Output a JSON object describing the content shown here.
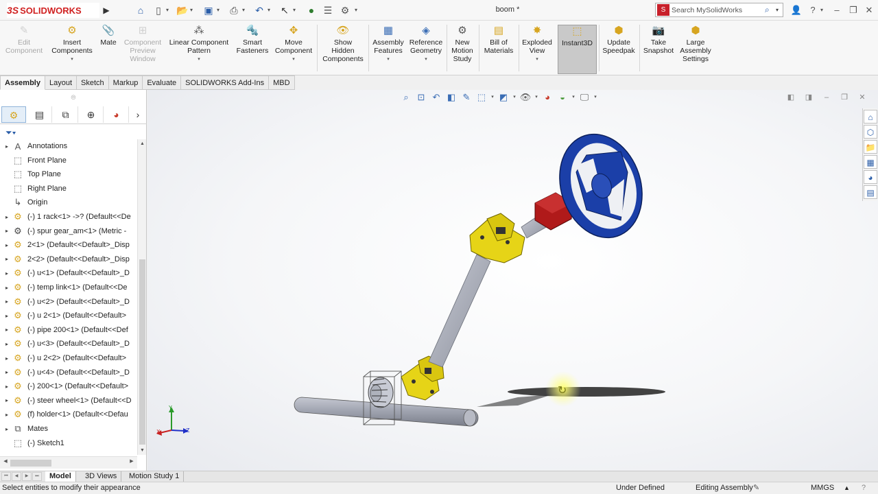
{
  "app": {
    "logo_ds": "3S",
    "logo_text": "SOLIDWORKS",
    "doc_title": "boom *"
  },
  "search": {
    "placeholder": "Search MySolidWorks"
  },
  "quick_access": [
    "home-icon",
    "new-icon",
    "open-icon",
    "save-icon",
    "print-icon",
    "undo-icon",
    "select-icon",
    "rebuild-icon",
    "file-properties-icon",
    "options-icon"
  ],
  "commands": [
    {
      "label": "Edit\nComponent",
      "icon": "edit-component-icon",
      "disabled": true
    },
    {
      "label": "Insert\nComponents",
      "icon": "insert-components-icon",
      "dropdown": true
    },
    {
      "label": "Mate",
      "icon": "mate-icon"
    },
    {
      "label": "Component\nPreview\nWindow",
      "icon": "component-preview-icon",
      "disabled": true
    },
    {
      "label": "Linear Component\nPattern",
      "icon": "linear-pattern-icon",
      "dropdown": true
    },
    {
      "label": "Smart\nFasteners",
      "icon": "smart-fasteners-icon"
    },
    {
      "label": "Move\nComponent",
      "icon": "move-component-icon",
      "dropdown": true
    },
    {
      "label": "Show\nHidden\nComponents",
      "icon": "show-hidden-icon"
    },
    {
      "label": "Assembly\nFeatures",
      "icon": "assembly-features-icon",
      "dropdown": true
    },
    {
      "label": "Reference\nGeometry",
      "icon": "reference-geometry-icon",
      "dropdown": true
    },
    {
      "label": "New\nMotion\nStudy",
      "icon": "motion-study-icon"
    },
    {
      "label": "Bill of\nMaterials",
      "icon": "bom-icon"
    },
    {
      "label": "Exploded\nView",
      "icon": "exploded-view-icon",
      "dropdown": true
    },
    {
      "label": "Instant3D",
      "icon": "instant3d-icon",
      "active": true
    },
    {
      "label": "Update\nSpeedpak",
      "icon": "speedpak-icon"
    },
    {
      "label": "Take\nSnapshot",
      "icon": "snapshot-icon"
    },
    {
      "label": "Large\nAssembly\nSettings",
      "icon": "large-assembly-icon"
    }
  ],
  "tabs": [
    "Assembly",
    "Layout",
    "Sketch",
    "Markup",
    "Evaluate",
    "SOLIDWORKS Add-Ins",
    "MBD"
  ],
  "active_tab": "Assembly",
  "tree": [
    {
      "label": "Annotations",
      "icon": "annotations-icon",
      "expand": true
    },
    {
      "label": "Front Plane",
      "icon": "plane-icon",
      "expand": false
    },
    {
      "label": "Top Plane",
      "icon": "plane-icon",
      "expand": false
    },
    {
      "label": "Right Plane",
      "icon": "plane-icon",
      "expand": false
    },
    {
      "label": "Origin",
      "icon": "origin-icon",
      "expand": false
    },
    {
      "label": "(-) 1 rack<1> ->? (Default<<De",
      "icon": "part-icon",
      "expand": true
    },
    {
      "label": "(-) spur gear_am<1> (Metric -",
      "icon": "toolbox-part-icon",
      "expand": true
    },
    {
      "label": "2<1> (Default<<Default>_Disp",
      "icon": "part-icon",
      "expand": true
    },
    {
      "label": "2<2> (Default<<Default>_Disp",
      "icon": "part-icon",
      "expand": true
    },
    {
      "label": "(-) u<1> (Default<<Default>_D",
      "icon": "part-icon",
      "expand": true
    },
    {
      "label": "(-) temp link<1> (Default<<De",
      "icon": "part-icon",
      "expand": true
    },
    {
      "label": "(-) u<2> (Default<<Default>_D",
      "icon": "part-icon",
      "expand": true
    },
    {
      "label": "(-) u 2<1> (Default<<Default>",
      "icon": "part-icon",
      "expand": true
    },
    {
      "label": "(-) pipe 200<1> (Default<<Def",
      "icon": "part-icon",
      "expand": true
    },
    {
      "label": "(-) u<3> (Default<<Default>_D",
      "icon": "part-icon",
      "expand": true
    },
    {
      "label": "(-) u 2<2> (Default<<Default>",
      "icon": "part-icon",
      "expand": true
    },
    {
      "label": "(-) u<4> (Default<<Default>_D",
      "icon": "part-icon",
      "expand": true
    },
    {
      "label": "(-) 200<1> (Default<<Default>",
      "icon": "part-icon",
      "expand": true
    },
    {
      "label": "(-) steer wheel<1> (Default<<D",
      "icon": "part-icon",
      "expand": true
    },
    {
      "label": "(f) holder<1> (Default<<Defau",
      "icon": "part-icon",
      "expand": true
    },
    {
      "label": "Mates",
      "icon": "mates-icon",
      "expand": true
    },
    {
      "label": "(-) Sketch1",
      "icon": "sketch-icon",
      "expand": false
    }
  ],
  "bottom_tabs": [
    "Model",
    "3D Views",
    "Motion Study 1"
  ],
  "active_bottom_tab": "Model",
  "status": {
    "message": "Select entities to modify their appearance",
    "defined": "Under Defined",
    "mode": "Editing Assembly",
    "units": "MMGS"
  },
  "colors": {
    "steer_wheel": "#1b3fa8",
    "u_joint": "#e6d417",
    "coupler": "#b01a1a",
    "shaft": "#a6aab6"
  }
}
